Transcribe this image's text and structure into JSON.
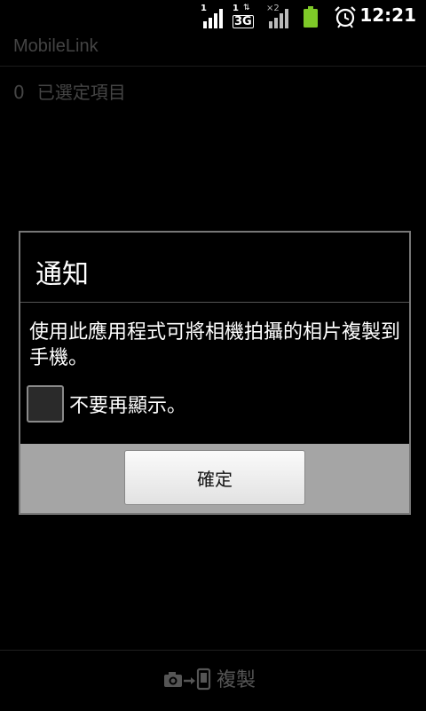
{
  "status_bar": {
    "signal1_label": "1",
    "signal2_label": "1",
    "signal2_tech": "3G",
    "signal3_label": "×2",
    "time": "12:21",
    "icons": [
      "signal-bars-icon",
      "3g-icon",
      "signal-bars-icon",
      "battery-icon",
      "alarm-clock-icon"
    ]
  },
  "app": {
    "title": "MobileLink",
    "selected_count": "0",
    "selected_label": "已選定項目"
  },
  "dialog": {
    "title": "通知",
    "message": "使用此應用程式可將相機拍攝的相片複製到手機。",
    "checkbox_label": "不要再顯示。",
    "checkbox_checked": false,
    "ok_label": "確定"
  },
  "bottom_bar": {
    "copy_label": "複製",
    "copy_icon": "camera-to-phone-icon"
  }
}
